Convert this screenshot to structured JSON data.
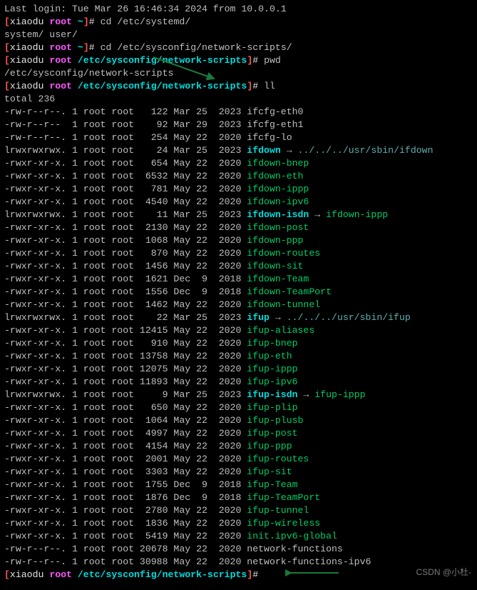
{
  "last_login": "Last login: Tue Mar 26 16:46:34 2024 from 10.0.0.1",
  "prompt": {
    "open": "[",
    "host": "xiaodu",
    "user": "root",
    "home": "~",
    "cwd": "/etc/sysconfig/network-scripts",
    "close": "]",
    "hash": "#"
  },
  "cmds": {
    "cd1": "cd /etc/systemd/",
    "tab": "system/ user/",
    "cd2": "cd /etc/sysconfig/network-scripts/",
    "pwd": "pwd",
    "pwd_out": "/etc/sysconfig/network-scripts",
    "ll": "ll",
    "total": "total 236"
  },
  "files": [
    {
      "perm": "-rw-r--r--.",
      "n": "1",
      "u": "root",
      "g": "root",
      "sz": "122",
      "mon": "Mar",
      "d": "25",
      "y": "2023",
      "name": "ifcfg-eth0",
      "t": "plain"
    },
    {
      "perm": "-rw-r--r-- ",
      "n": "1",
      "u": "root",
      "g": "root",
      "sz": "92",
      "mon": "Mar",
      "d": "29",
      "y": "2023",
      "name": "ifcfg-eth1",
      "t": "plain"
    },
    {
      "perm": "-rw-r--r--.",
      "n": "1",
      "u": "root",
      "g": "root",
      "sz": "254",
      "mon": "May",
      "d": "22",
      "y": "2020",
      "name": "ifcfg-lo",
      "t": "plain"
    },
    {
      "perm": "lrwxrwxrwx.",
      "n": "1",
      "u": "root",
      "g": "root",
      "sz": "24",
      "mon": "Mar",
      "d": "25",
      "y": "2023",
      "name": "ifdown",
      "t": "link_hl",
      "arrow": "→",
      "target": "../../../usr/sbin/ifdown"
    },
    {
      "perm": "-rwxr-xr-x.",
      "n": "1",
      "u": "root",
      "g": "root",
      "sz": "654",
      "mon": "May",
      "d": "22",
      "y": "2020",
      "name": "ifdown-bnep",
      "t": "exec"
    },
    {
      "perm": "-rwxr-xr-x.",
      "n": "1",
      "u": "root",
      "g": "root",
      "sz": "6532",
      "mon": "May",
      "d": "22",
      "y": "2020",
      "name": "ifdown-eth",
      "t": "exec"
    },
    {
      "perm": "-rwxr-xr-x.",
      "n": "1",
      "u": "root",
      "g": "root",
      "sz": "781",
      "mon": "May",
      "d": "22",
      "y": "2020",
      "name": "ifdown-ippp",
      "t": "exec"
    },
    {
      "perm": "-rwxr-xr-x.",
      "n": "1",
      "u": "root",
      "g": "root",
      "sz": "4540",
      "mon": "May",
      "d": "22",
      "y": "2020",
      "name": "ifdown-ipv6",
      "t": "exec"
    },
    {
      "perm": "lrwxrwxrwx.",
      "n": "1",
      "u": "root",
      "g": "root",
      "sz": "11",
      "mon": "Mar",
      "d": "25",
      "y": "2023",
      "name": "ifdown-isdn",
      "t": "link",
      "arrow": "→",
      "target": "ifdown-ippp"
    },
    {
      "perm": "-rwxr-xr-x.",
      "n": "1",
      "u": "root",
      "g": "root",
      "sz": "2130",
      "mon": "May",
      "d": "22",
      "y": "2020",
      "name": "ifdown-post",
      "t": "exec"
    },
    {
      "perm": "-rwxr-xr-x.",
      "n": "1",
      "u": "root",
      "g": "root",
      "sz": "1068",
      "mon": "May",
      "d": "22",
      "y": "2020",
      "name": "ifdown-ppp",
      "t": "exec"
    },
    {
      "perm": "-rwxr-xr-x.",
      "n": "1",
      "u": "root",
      "g": "root",
      "sz": "870",
      "mon": "May",
      "d": "22",
      "y": "2020",
      "name": "ifdown-routes",
      "t": "exec"
    },
    {
      "perm": "-rwxr-xr-x.",
      "n": "1",
      "u": "root",
      "g": "root",
      "sz": "1456",
      "mon": "May",
      "d": "22",
      "y": "2020",
      "name": "ifdown-sit",
      "t": "exec"
    },
    {
      "perm": "-rwxr-xr-x.",
      "n": "1",
      "u": "root",
      "g": "root",
      "sz": "1621",
      "mon": "Dec",
      "d": "9",
      "y": "2018",
      "name": "ifdown-Team",
      "t": "exec"
    },
    {
      "perm": "-rwxr-xr-x.",
      "n": "1",
      "u": "root",
      "g": "root",
      "sz": "1556",
      "mon": "Dec",
      "d": "9",
      "y": "2018",
      "name": "ifdown-TeamPort",
      "t": "exec"
    },
    {
      "perm": "-rwxr-xr-x.",
      "n": "1",
      "u": "root",
      "g": "root",
      "sz": "1462",
      "mon": "May",
      "d": "22",
      "y": "2020",
      "name": "ifdown-tunnel",
      "t": "exec"
    },
    {
      "perm": "lrwxrwxrwx.",
      "n": "1",
      "u": "root",
      "g": "root",
      "sz": "22",
      "mon": "Mar",
      "d": "25",
      "y": "2023",
      "name": "ifup",
      "t": "link_hl",
      "arrow": "→",
      "target": "../../../usr/sbin/ifup"
    },
    {
      "perm": "-rwxr-xr-x.",
      "n": "1",
      "u": "root",
      "g": "root",
      "sz": "12415",
      "mon": "May",
      "d": "22",
      "y": "2020",
      "name": "ifup-aliases",
      "t": "exec"
    },
    {
      "perm": "-rwxr-xr-x.",
      "n": "1",
      "u": "root",
      "g": "root",
      "sz": "910",
      "mon": "May",
      "d": "22",
      "y": "2020",
      "name": "ifup-bnep",
      "t": "exec"
    },
    {
      "perm": "-rwxr-xr-x.",
      "n": "1",
      "u": "root",
      "g": "root",
      "sz": "13758",
      "mon": "May",
      "d": "22",
      "y": "2020",
      "name": "ifup-eth",
      "t": "exec"
    },
    {
      "perm": "-rwxr-xr-x.",
      "n": "1",
      "u": "root",
      "g": "root",
      "sz": "12075",
      "mon": "May",
      "d": "22",
      "y": "2020",
      "name": "ifup-ippp",
      "t": "exec"
    },
    {
      "perm": "-rwxr-xr-x.",
      "n": "1",
      "u": "root",
      "g": "root",
      "sz": "11893",
      "mon": "May",
      "d": "22",
      "y": "2020",
      "name": "ifup-ipv6",
      "t": "exec"
    },
    {
      "perm": "lrwxrwxrwx.",
      "n": "1",
      "u": "root",
      "g": "root",
      "sz": "9",
      "mon": "Mar",
      "d": "25",
      "y": "2023",
      "name": "ifup-isdn",
      "t": "link",
      "arrow": "→",
      "target": "ifup-ippp"
    },
    {
      "perm": "-rwxr-xr-x.",
      "n": "1",
      "u": "root",
      "g": "root",
      "sz": "650",
      "mon": "May",
      "d": "22",
      "y": "2020",
      "name": "ifup-plip",
      "t": "exec"
    },
    {
      "perm": "-rwxr-xr-x.",
      "n": "1",
      "u": "root",
      "g": "root",
      "sz": "1064",
      "mon": "May",
      "d": "22",
      "y": "2020",
      "name": "ifup-plusb",
      "t": "exec"
    },
    {
      "perm": "-rwxr-xr-x.",
      "n": "1",
      "u": "root",
      "g": "root",
      "sz": "4997",
      "mon": "May",
      "d": "22",
      "y": "2020",
      "name": "ifup-post",
      "t": "exec"
    },
    {
      "perm": "-rwxr-xr-x.",
      "n": "1",
      "u": "root",
      "g": "root",
      "sz": "4154",
      "mon": "May",
      "d": "22",
      "y": "2020",
      "name": "ifup-ppp",
      "t": "exec"
    },
    {
      "perm": "-rwxr-xr-x.",
      "n": "1",
      "u": "root",
      "g": "root",
      "sz": "2001",
      "mon": "May",
      "d": "22",
      "y": "2020",
      "name": "ifup-routes",
      "t": "exec"
    },
    {
      "perm": "-rwxr-xr-x.",
      "n": "1",
      "u": "root",
      "g": "root",
      "sz": "3303",
      "mon": "May",
      "d": "22",
      "y": "2020",
      "name": "ifup-sit",
      "t": "exec"
    },
    {
      "perm": "-rwxr-xr-x.",
      "n": "1",
      "u": "root",
      "g": "root",
      "sz": "1755",
      "mon": "Dec",
      "d": "9",
      "y": "2018",
      "name": "ifup-Team",
      "t": "exec"
    },
    {
      "perm": "-rwxr-xr-x.",
      "n": "1",
      "u": "root",
      "g": "root",
      "sz": "1876",
      "mon": "Dec",
      "d": "9",
      "y": "2018",
      "name": "ifup-TeamPort",
      "t": "exec"
    },
    {
      "perm": "-rwxr-xr-x.",
      "n": "1",
      "u": "root",
      "g": "root",
      "sz": "2780",
      "mon": "May",
      "d": "22",
      "y": "2020",
      "name": "ifup-tunnel",
      "t": "exec"
    },
    {
      "perm": "-rwxr-xr-x.",
      "n": "1",
      "u": "root",
      "g": "root",
      "sz": "1836",
      "mon": "May",
      "d": "22",
      "y": "2020",
      "name": "ifup-wireless",
      "t": "exec"
    },
    {
      "perm": "-rwxr-xr-x.",
      "n": "1",
      "u": "root",
      "g": "root",
      "sz": "5419",
      "mon": "May",
      "d": "22",
      "y": "2020",
      "name": "init.ipv6-global",
      "t": "exec"
    },
    {
      "perm": "-rw-r--r--.",
      "n": "1",
      "u": "root",
      "g": "root",
      "sz": "20678",
      "mon": "May",
      "d": "22",
      "y": "2020",
      "name": "network-functions",
      "t": "plain"
    },
    {
      "perm": "-rw-r--r--.",
      "n": "1",
      "u": "root",
      "g": "root",
      "sz": "30988",
      "mon": "May",
      "d": "22",
      "y": "2020",
      "name": "network-functions-ipv6",
      "t": "plain"
    }
  ],
  "watermark": "CSDN @小杜-"
}
